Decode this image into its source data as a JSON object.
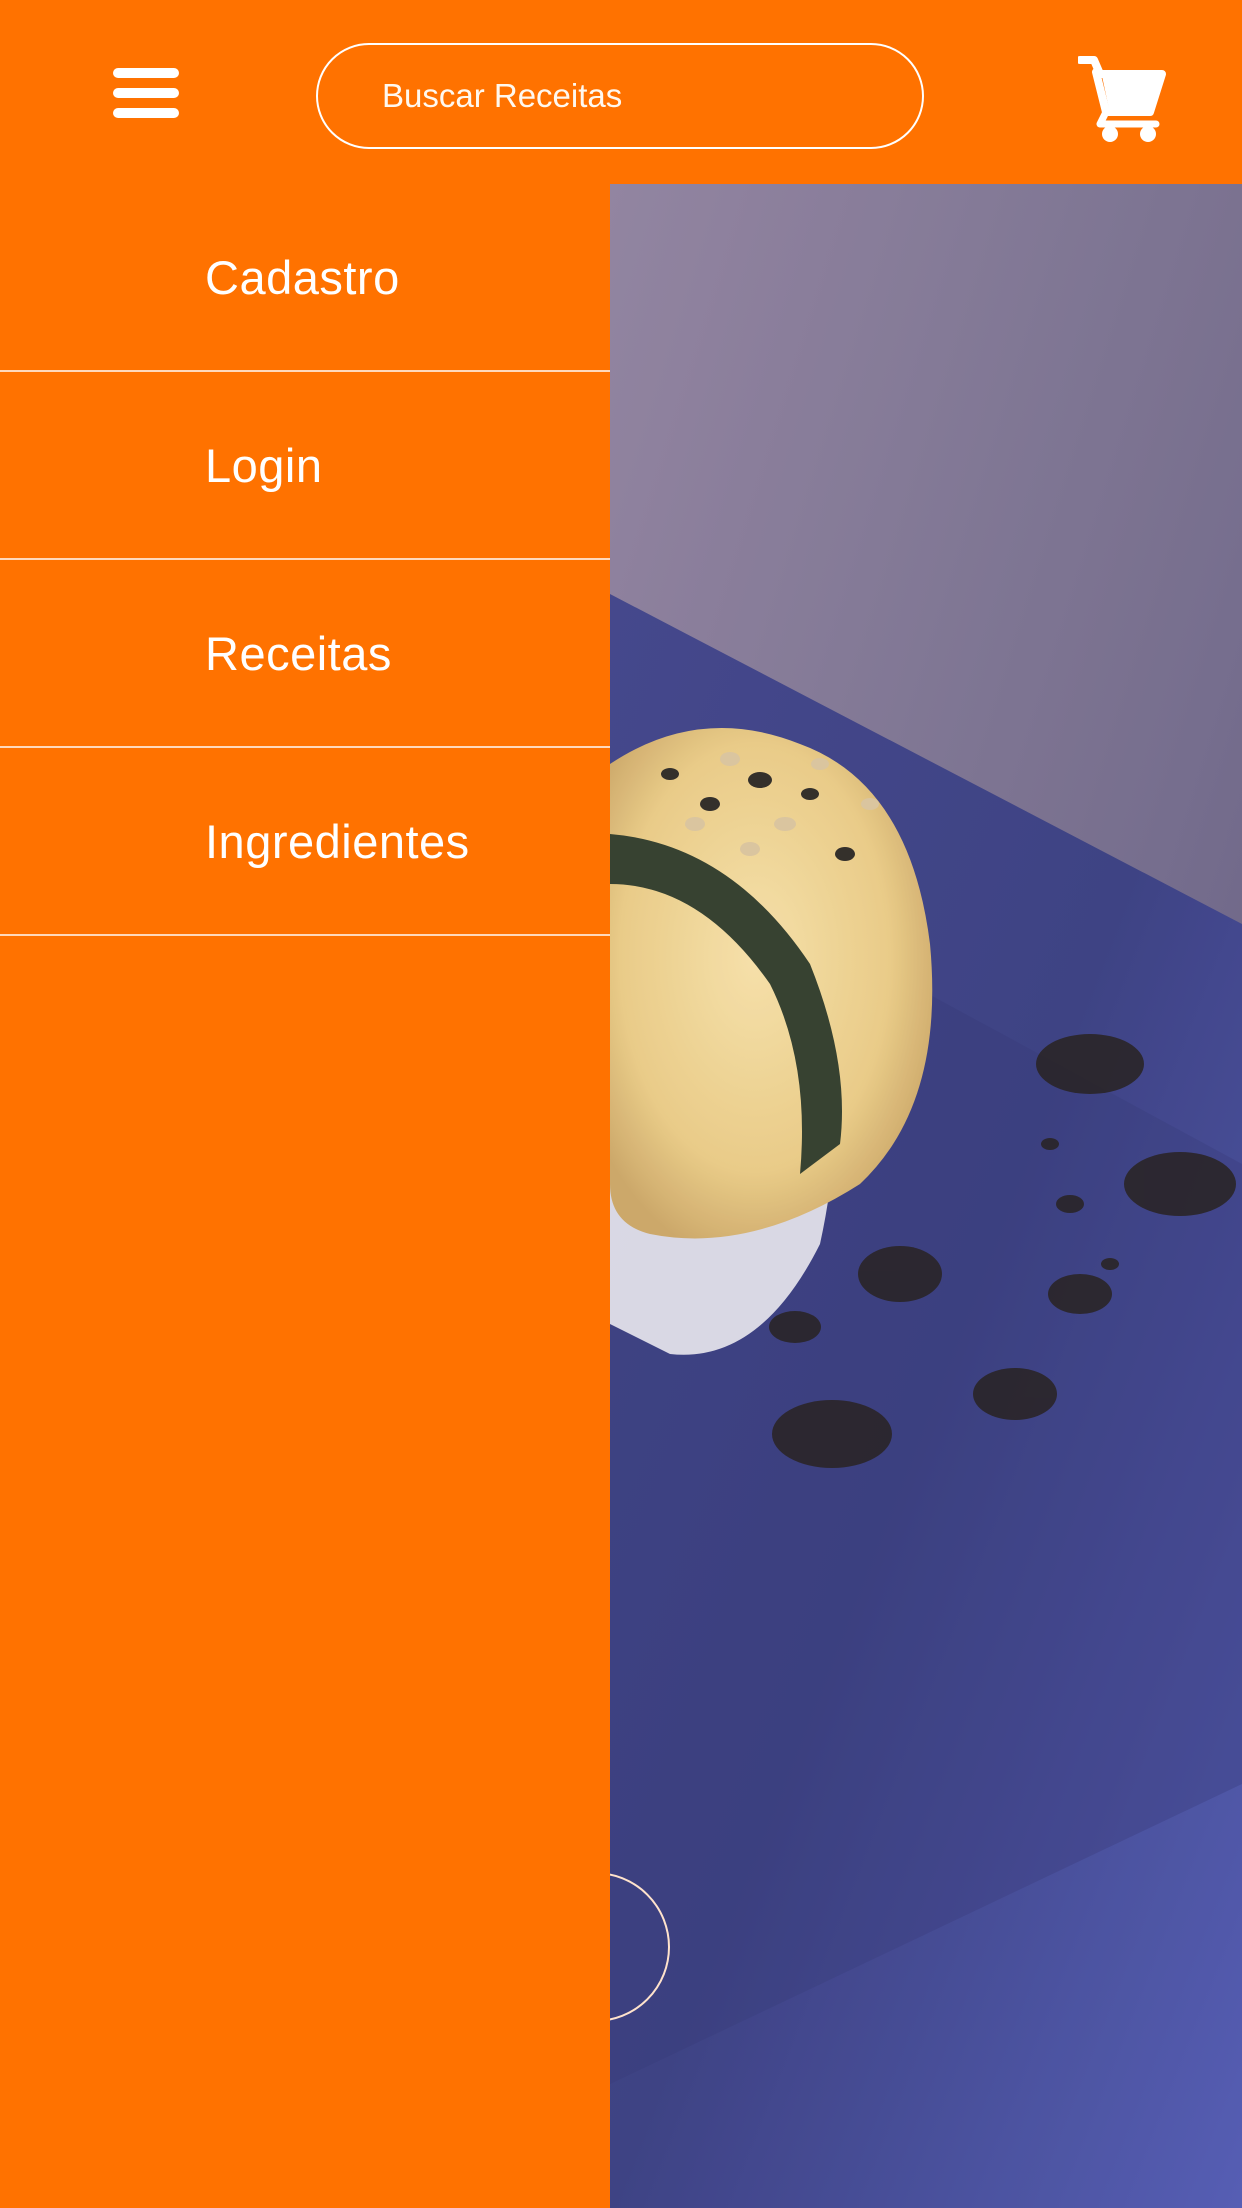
{
  "header": {
    "search": {
      "placeholder": "Buscar Receitas",
      "value": ""
    },
    "menu_icon": "hamburger-icon",
    "cart_icon": "cart-icon"
  },
  "drawer": {
    "items": [
      {
        "label": "Cadastro"
      },
      {
        "label": "Login"
      },
      {
        "label": "Receitas"
      },
      {
        "label": "Ingredientes"
      }
    ]
  },
  "colors": {
    "accent": "#ff7200",
    "text": "#ffffff",
    "divider": "#ffd9bb"
  }
}
